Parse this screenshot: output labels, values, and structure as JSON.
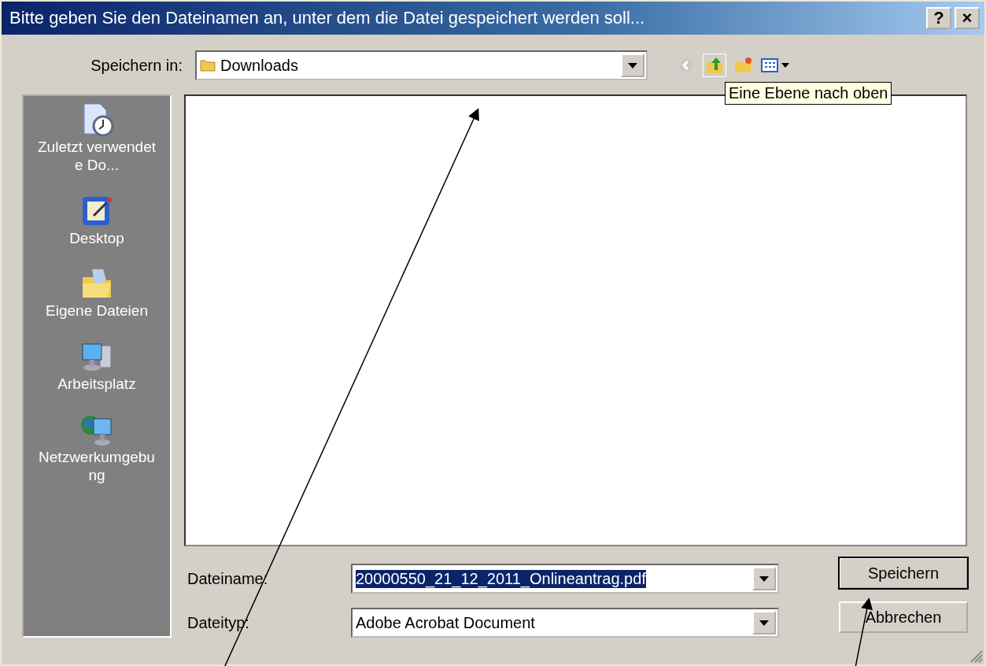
{
  "window": {
    "title": "Bitte geben Sie den Dateinamen an, unter dem die Datei gespeichert werden soll...",
    "help_button": "?",
    "close_button": "×"
  },
  "save_in": {
    "label": "Speichern in:",
    "value": "Downloads"
  },
  "toolbar": {
    "tooltip": "Eine Ebene nach oben"
  },
  "places": [
    {
      "kind": "recent",
      "label": "Zuletzt verwendete Do..."
    },
    {
      "kind": "desktop",
      "label": "Desktop"
    },
    {
      "kind": "documents",
      "label": "Eigene Dateien"
    },
    {
      "kind": "computer",
      "label": "Arbeitsplatz"
    },
    {
      "kind": "network",
      "label": "Netzwerkumgebung"
    }
  ],
  "file_name": {
    "label": "Dateiname:",
    "value": "20000550_21_12_2011_Onlineantrag.pdf",
    "selected": true
  },
  "file_type": {
    "label": "Dateityp:",
    "value": "Adobe Acrobat Document"
  },
  "buttons": [
    {
      "label": "Speichern",
      "default": true
    },
    {
      "label": "Abbrechen",
      "default": false
    }
  ]
}
